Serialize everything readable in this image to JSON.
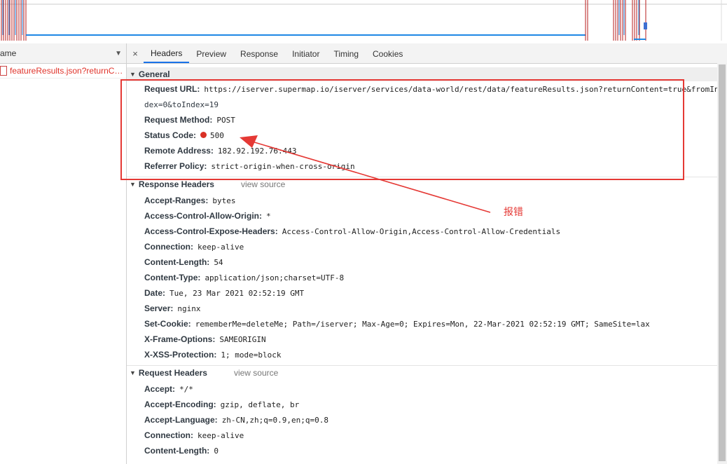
{
  "list": {
    "column_header": "ame",
    "sort_icon": "triangle-down",
    "rows": [
      {
        "name": "featureResults.json?returnCo..."
      }
    ]
  },
  "tabs": {
    "close_label": "×",
    "items": [
      "Headers",
      "Preview",
      "Response",
      "Initiator",
      "Timing",
      "Cookies"
    ],
    "active": "Headers"
  },
  "general": {
    "title": "General",
    "request_url_key": "Request URL:",
    "request_url_line1": "https://iserver.supermap.io/iserver/services/data-world/rest/data/featureResults.json?returnContent=true&fromIn",
    "request_url_line2": "dex=0&toIndex=19",
    "request_method_key": "Request Method:",
    "request_method": "POST",
    "status_code_key": "Status Code:",
    "status_code": "500",
    "remote_address_key": "Remote Address:",
    "remote_address": "182.92.192.76:443",
    "referrer_policy_key": "Referrer Policy:",
    "referrer_policy": "strict-origin-when-cross-origin"
  },
  "response_headers": {
    "title": "Response Headers",
    "view_source": "view source",
    "items": [
      {
        "k": "Accept-Ranges:",
        "v": "bytes"
      },
      {
        "k": "Access-Control-Allow-Origin:",
        "v": "*"
      },
      {
        "k": "Access-Control-Expose-Headers:",
        "v": "Access-Control-Allow-Origin,Access-Control-Allow-Credentials"
      },
      {
        "k": "Connection:",
        "v": "keep-alive"
      },
      {
        "k": "Content-Length:",
        "v": "54"
      },
      {
        "k": "Content-Type:",
        "v": "application/json;charset=UTF-8"
      },
      {
        "k": "Date:",
        "v": "Tue, 23 Mar 2021 02:52:19 GMT"
      },
      {
        "k": "Server:",
        "v": "nginx"
      },
      {
        "k": "Set-Cookie:",
        "v": "rememberMe=deleteMe; Path=/iserver; Max-Age=0; Expires=Mon, 22-Mar-2021 02:52:19 GMT; SameSite=lax"
      },
      {
        "k": "X-Frame-Options:",
        "v": "SAMEORIGIN"
      },
      {
        "k": "X-XSS-Protection:",
        "v": "1; mode=block"
      }
    ]
  },
  "request_headers": {
    "title": "Request Headers",
    "view_source": "view source",
    "items": [
      {
        "k": "Accept:",
        "v": "*/*"
      },
      {
        "k": "Accept-Encoding:",
        "v": "gzip, deflate, br"
      },
      {
        "k": "Accept-Language:",
        "v": "zh-CN,zh;q=0.9,en;q=0.8"
      },
      {
        "k": "Connection:",
        "v": "keep-alive"
      },
      {
        "k": "Content-Length:",
        "v": "0"
      }
    ]
  },
  "annotation": {
    "label": "报错",
    "color": "#e53935"
  },
  "colors": {
    "error_red": "#d93025",
    "active_tab": "#1a73e8",
    "timeline_blue": "#1e88e5",
    "timeline_red": "#b71c1c"
  }
}
